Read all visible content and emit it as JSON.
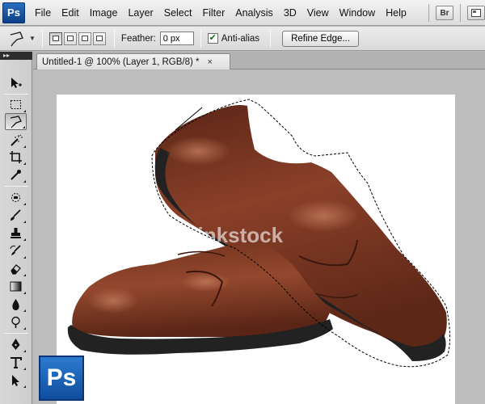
{
  "app": {
    "badge": "Ps",
    "menu": [
      "File",
      "Edit",
      "Image",
      "Layer",
      "Select",
      "Filter",
      "Analysis",
      "3D",
      "View",
      "Window",
      "Help"
    ],
    "bridge_badge": "Br"
  },
  "options": {
    "feather_label": "Feather:",
    "feather_value": "0 px",
    "antialias_label": "Anti-alias",
    "antialias_checked": true,
    "refine_edge_label": "Refine Edge..."
  },
  "panel_strip": "▸▸",
  "document": {
    "tab_title": "Untitled-1 @ 100% (Layer 1, RGB/8) *",
    "close_glyph": "×",
    "watermark": "thinkstock"
  },
  "tools": [
    {
      "name": "move-tool-icon"
    },
    {
      "name": "rectangular-marquee-tool-icon"
    },
    {
      "name": "polygonal-lasso-tool-icon",
      "active": true
    },
    {
      "name": "magic-wand-tool-icon"
    },
    {
      "name": "crop-tool-icon"
    },
    {
      "name": "eyedropper-tool-icon"
    },
    {
      "name": "spot-healing-brush-tool-icon"
    },
    {
      "name": "brush-tool-icon"
    },
    {
      "name": "clone-stamp-tool-icon"
    },
    {
      "name": "history-brush-tool-icon"
    },
    {
      "name": "eraser-tool-icon"
    },
    {
      "name": "gradient-tool-icon"
    },
    {
      "name": "blur-tool-icon"
    },
    {
      "name": "dodge-tool-icon"
    },
    {
      "name": "pen-tool-icon"
    },
    {
      "name": "type-tool-icon"
    },
    {
      "name": "path-selection-tool-icon"
    }
  ],
  "corner_logo": "Ps",
  "colors": {
    "leather_dark": "#4a1f12",
    "leather_mid": "#7a3522",
    "leather_light": "#a4563a",
    "sole": "#2a2a2a",
    "ps_blue": "#1559b0"
  }
}
